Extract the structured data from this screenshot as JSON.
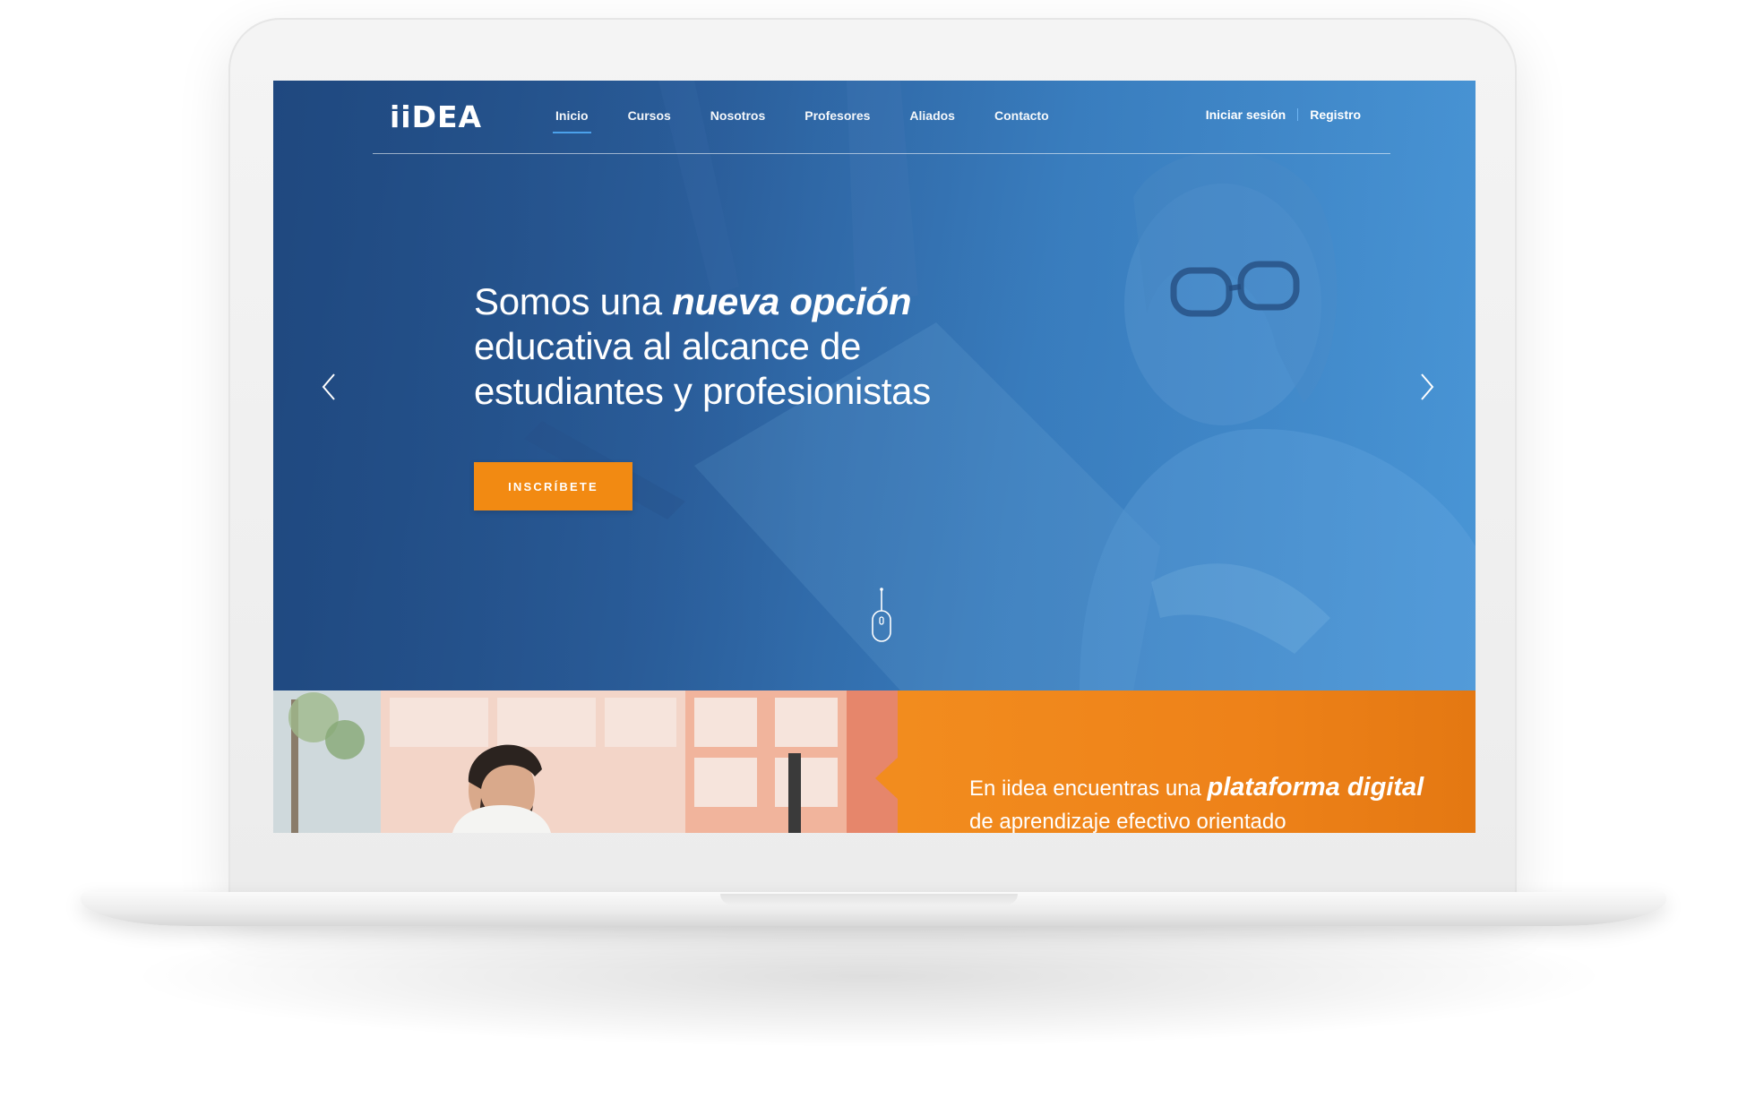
{
  "colors": {
    "primary_blue": "#2f66a5",
    "accent_orange": "#f28a12",
    "underline_blue": "#4ea6f0"
  },
  "header": {
    "logo_text": "iiDEA",
    "nav": [
      {
        "label": "Inicio",
        "active": true
      },
      {
        "label": "Cursos",
        "active": false
      },
      {
        "label": "Nosotros",
        "active": false
      },
      {
        "label": "Profesores",
        "active": false
      },
      {
        "label": "Aliados",
        "active": false
      },
      {
        "label": "Contacto",
        "active": false
      }
    ],
    "login_label": "Iniciar sesión",
    "register_label": "Registro"
  },
  "hero": {
    "headline_part1": "Somos una ",
    "headline_emphasis": "nueva opción",
    "headline_part2": " educativa al alcance de estudiantes y profesionistas",
    "cta_label": "INSCRÍBETE",
    "prev_icon": "chevron-left-icon",
    "next_icon": "chevron-right-icon",
    "scroll_icon": "mouse-scroll-icon"
  },
  "promo": {
    "text_part1": "En iidea encuentras una ",
    "text_emphasis": "plataforma digital",
    "text_part2": " de aprendizaje efectivo orientado"
  }
}
